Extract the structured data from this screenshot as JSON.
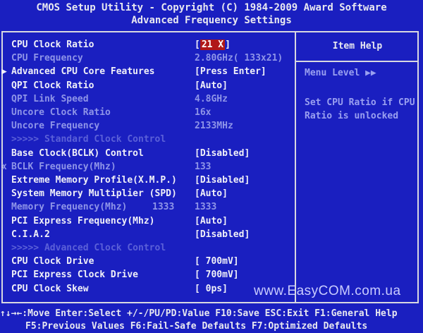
{
  "header": {
    "line1": "CMOS Setup Utility - Copyright (C) 1984-2009 Award Software",
    "line2": "Advanced Frequency Settings"
  },
  "help": {
    "title": "Item Help",
    "menu_level": "Menu Level  ▶▶",
    "text": "Set CPU Ratio if CPU Ratio is unlocked"
  },
  "rows": [
    {
      "label": "CPU Clock Ratio",
      "value": "21 X",
      "style": "w",
      "selected": true
    },
    {
      "label": "CPU Frequency",
      "value": "2.80GHz( 133x21)",
      "style": "g"
    },
    {
      "label": "Advanced CPU Core Features",
      "value": "[Press Enter]",
      "style": "w",
      "marker": "▶"
    },
    {
      "label": "QPI Clock Ratio",
      "value": "[Auto]",
      "style": "w"
    },
    {
      "label": "QPI Link Speed",
      "value": "4.8GHz",
      "style": "g"
    },
    {
      "label": "Uncore Clock Ratio",
      "value": "16x",
      "style": "g"
    },
    {
      "label": "Uncore Frequency",
      "value": "2133MHz",
      "style": "g"
    },
    {
      "label": ">>>>>  Standard Clock Control",
      "value": "",
      "style": "dim"
    },
    {
      "label": "Base Clock(BCLK) Control",
      "value": "[Disabled]",
      "style": "w"
    },
    {
      "label": "BCLK Frequency(Mhz)",
      "value": "133",
      "style": "g",
      "marker": "x"
    },
    {
      "label": "Extreme Memory Profile(X.M.P.)",
      "value": "[Disabled]",
      "style": "w"
    },
    {
      "label": "System Memory Multiplier (SPD)",
      "value": "[Auto]",
      "style": "w"
    },
    {
      "label": "Memory Frequency(Mhz)",
      "mid": "1333",
      "value": "1333",
      "style": "g"
    },
    {
      "label": "PCI Express Frequency(Mhz)",
      "value": "[Auto]",
      "style": "w"
    },
    {
      "label": "C.I.A.2",
      "value": "[Disabled]",
      "style": "w"
    },
    {
      "label": ">>>>>  Advanced Clock Control",
      "value": "",
      "style": "dim"
    },
    {
      "label": "CPU Clock Drive",
      "value": "[ 700mV]",
      "style": "w"
    },
    {
      "label": "PCI Express Clock Drive",
      "value": "[ 700mV]",
      "style": "w"
    },
    {
      "label": "CPU Clock Skew",
      "value": "[   0ps]",
      "style": "w"
    }
  ],
  "footer": {
    "line1": "↑↓→←:Move  Enter:Select  +/-/PU/PD:Value  F10:Save  ESC:Exit  F1:General Help",
    "line2": "F5:Previous Values  F6:Fail-Safe Defaults  F7:Optimized Defaults"
  },
  "watermark": "www.EasyCOM.com.ua"
}
